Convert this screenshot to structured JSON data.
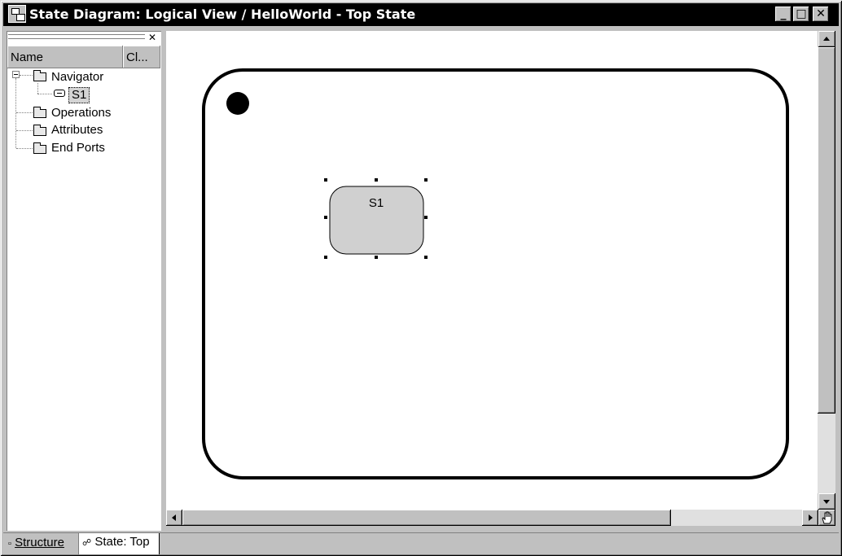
{
  "window": {
    "title": "State Diagram: Logical View / HelloWorld - Top State",
    "controls": {
      "minimize": "_",
      "maximize": "□",
      "close": "✕"
    }
  },
  "navigator_panel": {
    "columns": [
      "Name",
      "Cl..."
    ],
    "tree": [
      {
        "label": "Navigator",
        "icon": "folder-open-icon",
        "expanded": true,
        "children": [
          {
            "label": "S1",
            "icon": "state-icon",
            "selected": true
          }
        ]
      },
      {
        "label": "Operations",
        "icon": "folder-icon"
      },
      {
        "label": "Attributes",
        "icon": "folder-icon"
      },
      {
        "label": "End Ports",
        "icon": "folder-icon"
      }
    ]
  },
  "diagram": {
    "top_state_label": "",
    "states": [
      {
        "name": "S1",
        "selected": true
      }
    ],
    "initial_point": true
  },
  "tabs": [
    {
      "label": "Structure",
      "icon": "structure-icon",
      "active": false
    },
    {
      "label": "State: Top",
      "icon": "state-tree-icon",
      "active": true
    }
  ],
  "colors": {
    "titlebar": "#000000",
    "state_fill": "#d0d0d0",
    "face": "#c0c0c0"
  }
}
